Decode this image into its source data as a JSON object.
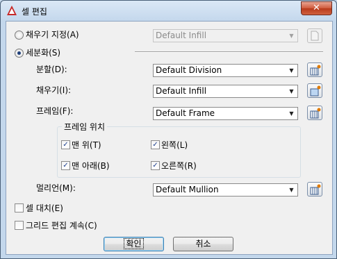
{
  "window": {
    "title": "셀 편집",
    "close_glyph": "✕"
  },
  "fill_assign": {
    "label": "채우기 지정(A)",
    "selected": false,
    "value": "Default Infill"
  },
  "subdivide": {
    "label": "세분화(S)",
    "selected": true
  },
  "division": {
    "label": "분할(D):",
    "value": "Default Division"
  },
  "infill": {
    "label": "채우기(I):",
    "value": "Default Infill"
  },
  "frame": {
    "label": "프레임(F):",
    "value": "Default Frame"
  },
  "frame_position": {
    "title": "프레임 위치",
    "top": {
      "label": "맨 위(T)",
      "checked": true
    },
    "left": {
      "label": "왼쪽(L)",
      "checked": true
    },
    "bottom": {
      "label": "맨 아래(B)",
      "checked": true
    },
    "right": {
      "label": "오른쪽(R)",
      "checked": true
    }
  },
  "mullion": {
    "label": "멀리언(M):",
    "value": "Default Mullion"
  },
  "cell_replace": {
    "label": "셀 대치(E)",
    "checked": false
  },
  "continue_grid_edit": {
    "label": "그리드 편집 계속(C)",
    "checked": false
  },
  "buttons": {
    "ok": "확인",
    "cancel": "취소"
  },
  "icons": {
    "app": "autocad-icon",
    "style_browse": "style-browse-icon"
  },
  "colors": {
    "check_mark": "#1d3f8f",
    "radio_dot": "#1f3f7a",
    "icon_accent": "#e07a00"
  }
}
